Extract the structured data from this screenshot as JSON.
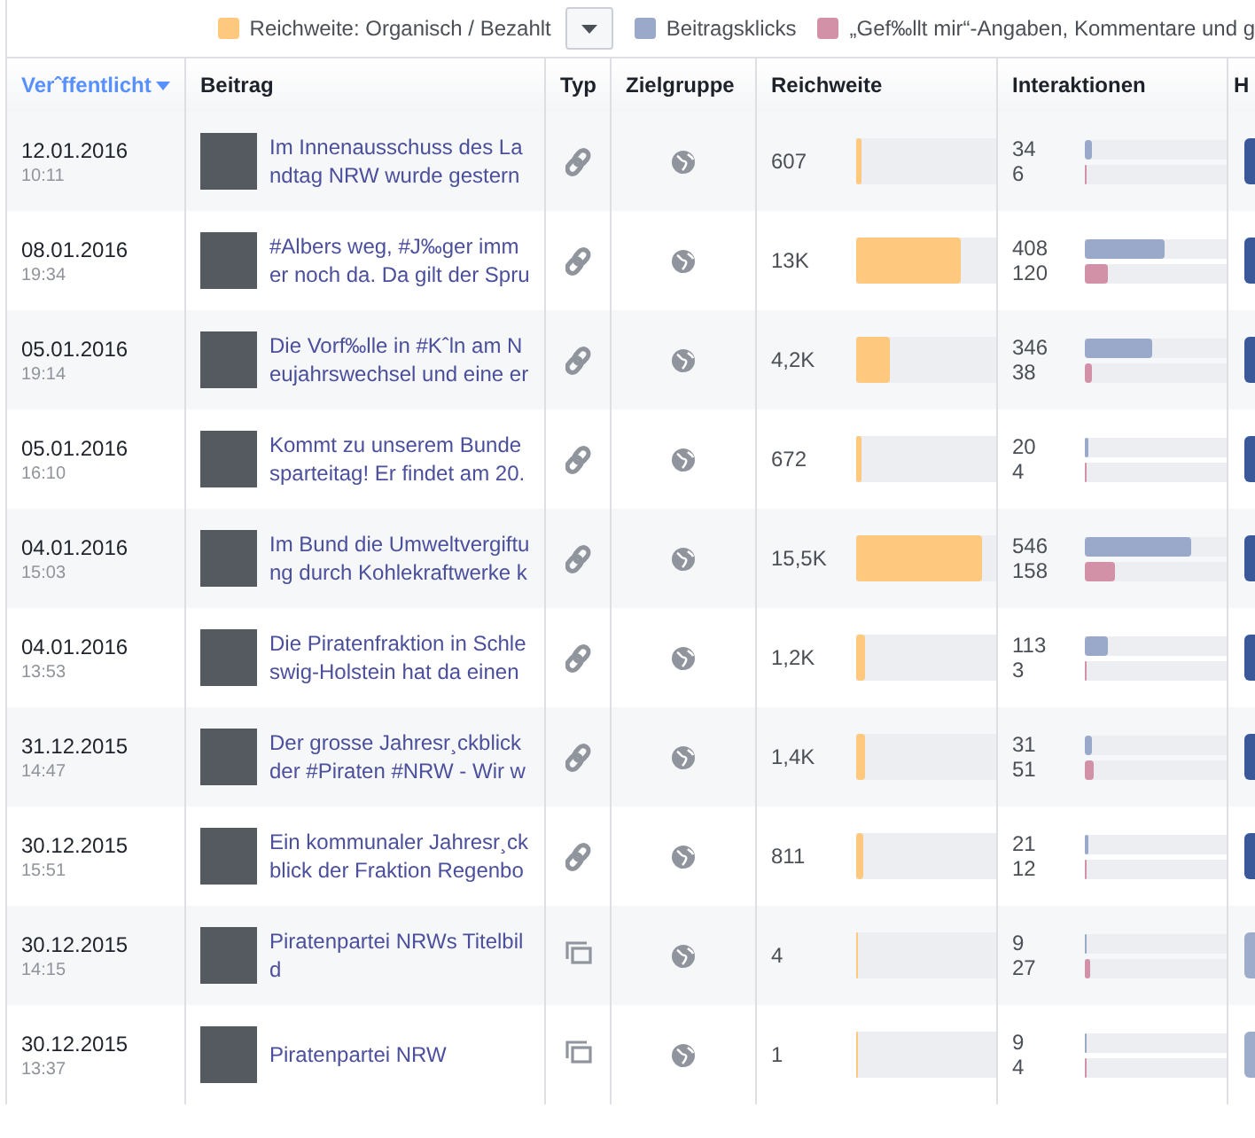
{
  "legend": {
    "items": [
      {
        "label": "Reichweite: Organisch / Bezahlt",
        "color": "#ffc87f"
      },
      {
        "label": "Beitragsklicks",
        "color": "#9aa8c9"
      },
      {
        "label": "„Gef‰llt mir“-Angaben, Kommentare und g",
        "color": "#d391a8"
      }
    ]
  },
  "table": {
    "columns": [
      {
        "label": "Verˆffentlicht",
        "selected": true
      },
      {
        "label": "Beitrag",
        "selected": false
      },
      {
        "label": "Typ",
        "selected": false
      },
      {
        "label": "Zielgruppe",
        "selected": false
      },
      {
        "label": "Reichweite",
        "selected": false
      },
      {
        "label": "Interaktionen",
        "selected": false
      },
      {
        "label": "H",
        "selected": false
      }
    ],
    "rows": [
      {
        "date": "12.01.2016",
        "time": "10:11",
        "post": [
          "Im Innenausschuss des La",
          "ndtag NRW wurde gestern"
        ],
        "kind": "link",
        "reach": "607",
        "reach_bar": {
          "level": 0.04
        },
        "clicks": "34",
        "clicks_bar": {
          "level": 0.05
        },
        "likes": "6",
        "likes_bar": {
          "level": 0.01
        },
        "boost": {
          "disabled": false
        }
      },
      {
        "date": "08.01.2016",
        "time": "19:34",
        "post": [
          "#Albers weg, #J‰ger imm",
          "er noch da. Da gilt der Spru"
        ],
        "kind": "link",
        "reach": "13K",
        "reach_bar": {
          "level": 0.75
        },
        "clicks": "408",
        "clicks_bar": {
          "level": 0.56
        },
        "likes": "120",
        "likes_bar": {
          "level": 0.16
        },
        "boost": {
          "disabled": false
        }
      },
      {
        "date": "05.01.2016",
        "time": "19:14",
        "post": [
          "Die Vorf‰lle in #Kˆln am N",
          "eujahrswechsel und eine er"
        ],
        "kind": "link",
        "reach": "4,2K",
        "reach_bar": {
          "level": 0.24
        },
        "clicks": "346",
        "clicks_bar": {
          "level": 0.47
        },
        "likes": "38",
        "likes_bar": {
          "level": 0.05
        },
        "boost": {
          "disabled": false
        }
      },
      {
        "date": "05.01.2016",
        "time": "16:10",
        "post": [
          "Kommt zu unserem Bunde",
          "sparteitag! Er findet am 20."
        ],
        "kind": "link",
        "reach": "672",
        "reach_bar": {
          "level": 0.04
        },
        "clicks": "20",
        "clicks_bar": {
          "level": 0.03
        },
        "likes": "4",
        "likes_bar": {
          "level": 0.01
        },
        "boost": {
          "disabled": false
        }
      },
      {
        "date": "04.01.2016",
        "time": "15:03",
        "post": [
          "Im Bund die Umweltvergiftu",
          "ng durch Kohlekraftwerke k"
        ],
        "kind": "link",
        "reach": "15,5K",
        "reach_bar": {
          "level": 0.9
        },
        "clicks": "546",
        "clicks_bar": {
          "level": 0.75
        },
        "likes": "158",
        "likes_bar": {
          "level": 0.21
        },
        "boost": {
          "disabled": false
        }
      },
      {
        "date": "04.01.2016",
        "time": "13:53",
        "post": [
          "Die Piratenfraktion in Schle",
          "swig-Holstein hat da einen"
        ],
        "kind": "link",
        "reach": "1,2K",
        "reach_bar": {
          "level": 0.07
        },
        "clicks": "113",
        "clicks_bar": {
          "level": 0.16
        },
        "likes": "3",
        "likes_bar": {
          "level": 0.01
        },
        "boost": {
          "disabled": false
        }
      },
      {
        "date": "31.12.2015",
        "time": "14:47",
        "post": [
          "Der grosse Jahresr¸ckblick",
          "der #Piraten #NRW - Wir w"
        ],
        "kind": "link",
        "reach": "1,4K",
        "reach_bar": {
          "level": 0.07
        },
        "clicks": "31",
        "clicks_bar": {
          "level": 0.05
        },
        "likes": "51",
        "likes_bar": {
          "level": 0.06
        },
        "boost": {
          "disabled": false
        }
      },
      {
        "date": "30.12.2015",
        "time": "15:51",
        "post": [
          "Ein kommunaler Jahresr¸ck",
          "blick der Fraktion Regenbo"
        ],
        "kind": "link",
        "reach": "811",
        "reach_bar": {
          "level": 0.05
        },
        "clicks": "21",
        "clicks_bar": {
          "level": 0.02
        },
        "likes": "12",
        "likes_bar": {
          "level": 0.01
        },
        "boost": {
          "disabled": false
        }
      },
      {
        "date": "30.12.2015",
        "time": "14:15",
        "post": [
          "Piratenpartei NRWs Titelbil",
          "d"
        ],
        "kind": "album",
        "reach": "4",
        "reach_bar": {
          "level": 0.01
        },
        "clicks": "9",
        "clicks_bar": {
          "level": 0.01
        },
        "likes": "27",
        "likes_bar": {
          "level": 0.04
        },
        "boost": {
          "disabled": true
        }
      },
      {
        "date": "30.12.2015",
        "time": "13:37",
        "post": [
          "Piratenpartei NRW"
        ],
        "kind": "album",
        "reach": "1",
        "reach_bar": {
          "level": 0.01
        },
        "clicks": "9",
        "clicks_bar": {
          "level": 0.01
        },
        "likes": "4",
        "likes_bar": {
          "level": 0.01
        },
        "boost": {
          "disabled": true
        }
      }
    ]
  }
}
